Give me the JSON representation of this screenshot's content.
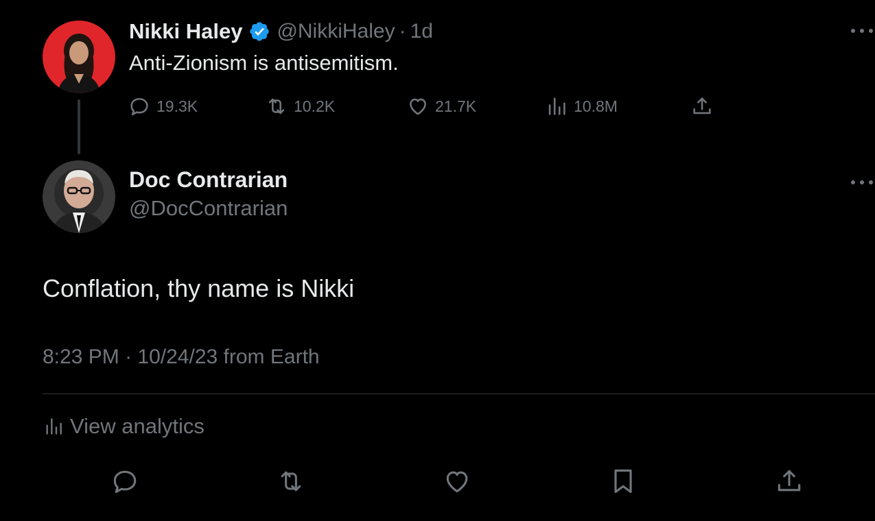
{
  "parent_tweet": {
    "author_name": "Nikki Haley",
    "handle": "@NikkiHaley",
    "separator": "·",
    "time_ago": "1d",
    "verified": true,
    "text": "Anti-Zionism is antisemitism.",
    "metrics": {
      "replies": "19.3K",
      "retweets": "10.2K",
      "likes": "21.7K",
      "views": "10.8M"
    }
  },
  "main_tweet": {
    "author_name": "Doc Contrarian",
    "handle": "@DocContrarian",
    "text": "Conflation, thy name is Nikki",
    "time": "8:23 PM",
    "separator": "·",
    "date": "10/24/23",
    "source": "from Earth",
    "analytics_label": "View analytics"
  },
  "icons": {
    "reply": "reply-icon",
    "retweet": "retweet-icon",
    "like": "heart-icon",
    "views": "views-icon",
    "share": "share-icon",
    "bookmark": "bookmark-icon",
    "more": "more-icon",
    "verified": "verified-badge-icon"
  },
  "colors": {
    "background": "#000000",
    "primary_text": "#e7e9ea",
    "secondary_text": "#71767b",
    "verified_blue": "#1d9bf0",
    "divider": "#2f3336",
    "avatar_red": "#e0262b"
  }
}
